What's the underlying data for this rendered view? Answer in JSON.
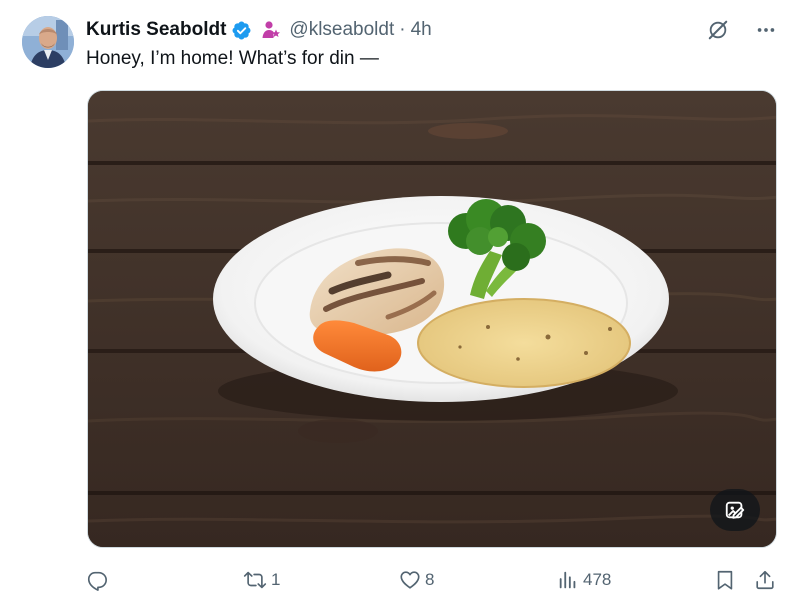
{
  "author": {
    "display_name": "Kurtis Seaboldt",
    "handle": "@klseaboldt",
    "separator": "·",
    "time": "4h",
    "verified": true
  },
  "tweet": {
    "text": "Honey, I’m home! What’s for din —"
  },
  "media": {
    "type": "photo",
    "badge_icon": "image-edit-icon"
  },
  "actions": {
    "reply_count": "",
    "retweet_count": "1",
    "like_count": "8",
    "views_count": "478"
  },
  "colors": {
    "verified_blue": "#1d9bf0",
    "affiliate_pink": "#c13ea8",
    "muted_text": "#536471",
    "primary_text": "#0f1419"
  },
  "icons": {
    "grok": "grok-icon",
    "more": "more-options-icon",
    "reply": "reply-icon",
    "retweet": "retweet-icon",
    "like": "heart-icon",
    "views": "views-icon",
    "bookmark": "bookmark-icon",
    "share": "share-icon"
  }
}
